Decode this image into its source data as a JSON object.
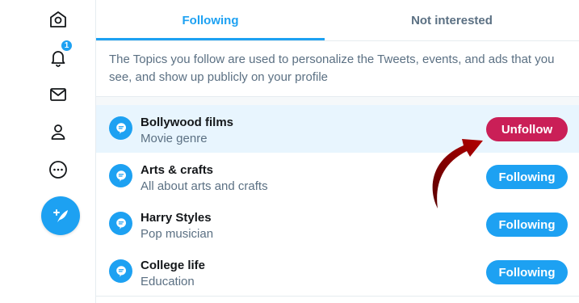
{
  "sidebar": {
    "notifications_badge": "1"
  },
  "tabs": {
    "following": "Following",
    "not_interested": "Not interested"
  },
  "description": "The Topics you follow are used to personalize the Tweets, events, and ads that you see, and show up publicly on your profile",
  "topics": [
    {
      "name": "Bollywood films",
      "subtitle": "Movie genre",
      "button": "Unfollow"
    },
    {
      "name": "Arts & crafts",
      "subtitle": "All about arts and crafts",
      "button": "Following"
    },
    {
      "name": "Harry Styles",
      "subtitle": "Pop musician",
      "button": "Following"
    },
    {
      "name": "College life",
      "subtitle": "Education",
      "button": "Following"
    }
  ],
  "colors": {
    "accent": "#1da1f2",
    "unfollow": "#ca1f57",
    "highlight_row": "#e8f5fe",
    "annotation_arrow": "#8b0000"
  },
  "icons": {
    "sidebar": [
      "home-icon",
      "bell-icon",
      "envelope-icon",
      "person-icon",
      "more-icon",
      "compose-tweet-icon"
    ],
    "topic": "topic-bubble-icon"
  }
}
